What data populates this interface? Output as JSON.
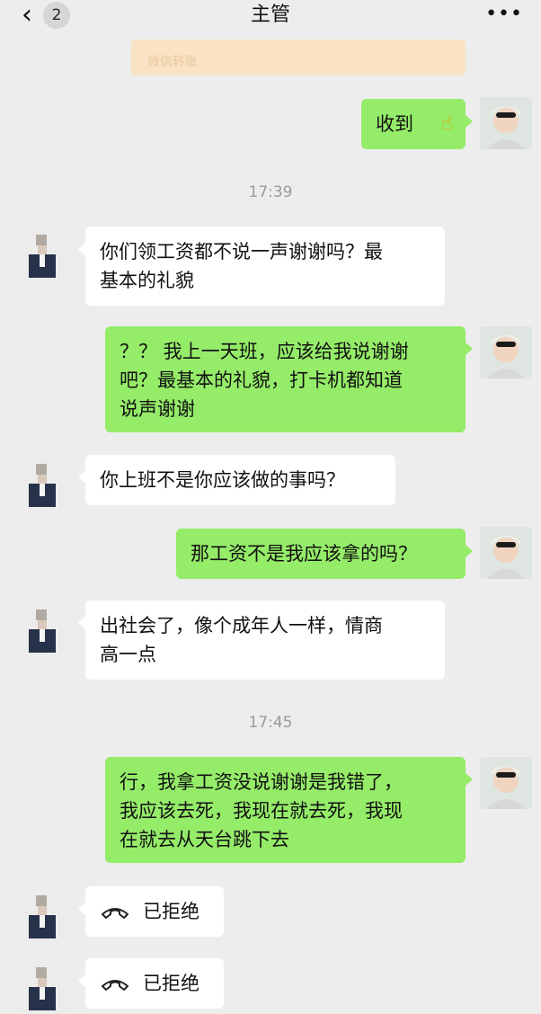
{
  "header": {
    "back_icon": "chevron-left-icon",
    "unread_count": "2",
    "title": "主管",
    "more_icon": "more-dots-icon"
  },
  "transfer": {
    "label": "微信转账"
  },
  "timestamps": [
    "17:39",
    "17:45"
  ],
  "messages": [
    {
      "side": "right",
      "text": "收到",
      "emoji": "thumbs-up-emoji"
    },
    {
      "side": "left",
      "line1": "你们领工资都不说一声谢谢吗？最",
      "line2": "基本的礼貌"
    },
    {
      "side": "right",
      "line1": "？？ 我上一天班，应该给我说谢谢",
      "line2": "吧？最基本的礼貌，打卡机都知道",
      "line3": "说声谢谢"
    },
    {
      "side": "left",
      "text": "你上班不是你应该做的事吗？"
    },
    {
      "side": "right",
      "text": "那工资不是我应该拿的吗？"
    },
    {
      "side": "left",
      "line1": "出社会了，像个成年人一样，情商",
      "line2": "高一点"
    },
    {
      "side": "right",
      "line1": "行，我拿工资没说谢谢是我错了，",
      "line2": "我应该去死，我现在就去死，我现",
      "line3": "在就去从天台跳下去"
    },
    {
      "side": "left",
      "type": "call",
      "text": "已拒绝",
      "icon": "phone-declined-icon"
    },
    {
      "side": "left",
      "type": "call",
      "text": "已拒绝",
      "icon": "phone-declined-icon"
    }
  ],
  "colors": {
    "self_bubble": "#95ec69",
    "other_bubble": "#ffffff",
    "background": "#ededed"
  }
}
